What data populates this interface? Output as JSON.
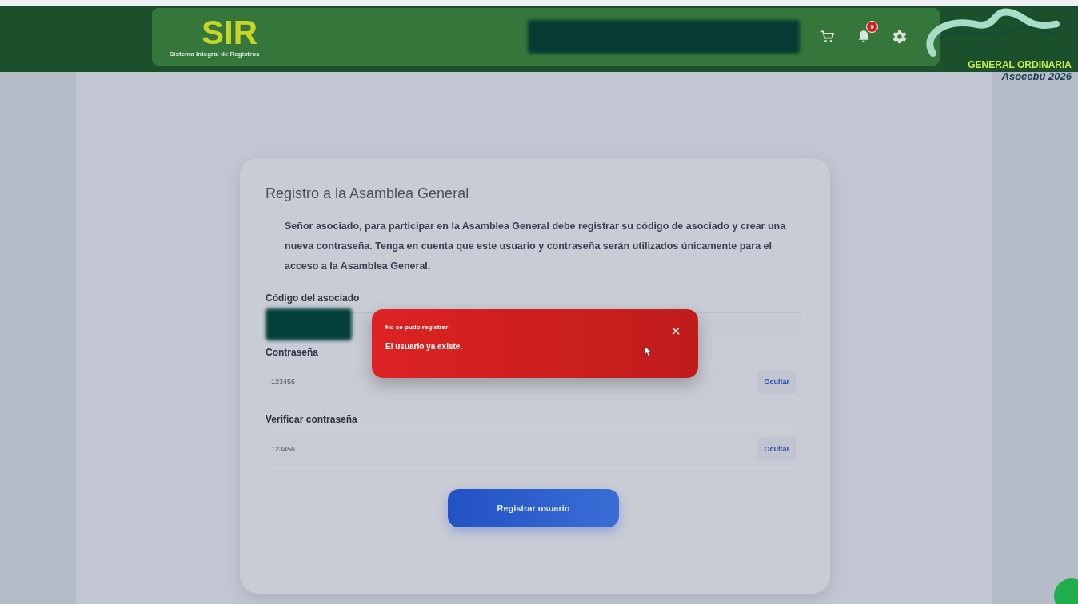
{
  "header": {
    "app_name": "SIR",
    "app_subtitle": "Sistema Integral de Registros",
    "notification_count": "9",
    "event_logo": {
      "line_1": "GENERAL ORDINARIA",
      "line_2": "Asocebú 2026"
    }
  },
  "form": {
    "title": "Registro a la Asamblea General",
    "intro": "Señor asociado, para participar en la Asamblea General debe registrar su código de asociado y crear una nueva contraseña. Tenga en cuenta que este usuario y contraseña serán utilizados únicamente para el acceso a la Asamblea General.",
    "fields": [
      {
        "kind": "code",
        "label": "Código del asociado"
      },
      {
        "kind": "password",
        "label": "Contraseña",
        "value": "123456",
        "toggle": "Ocultar"
      },
      {
        "kind": "password",
        "label": "Verificar contraseña",
        "value": "123456",
        "toggle": "Ocultar"
      }
    ],
    "submit": "Registrar usuario"
  },
  "toast": {
    "title": "No se pudo registrar",
    "message": "El usuario ya existe.",
    "close": "×"
  }
}
